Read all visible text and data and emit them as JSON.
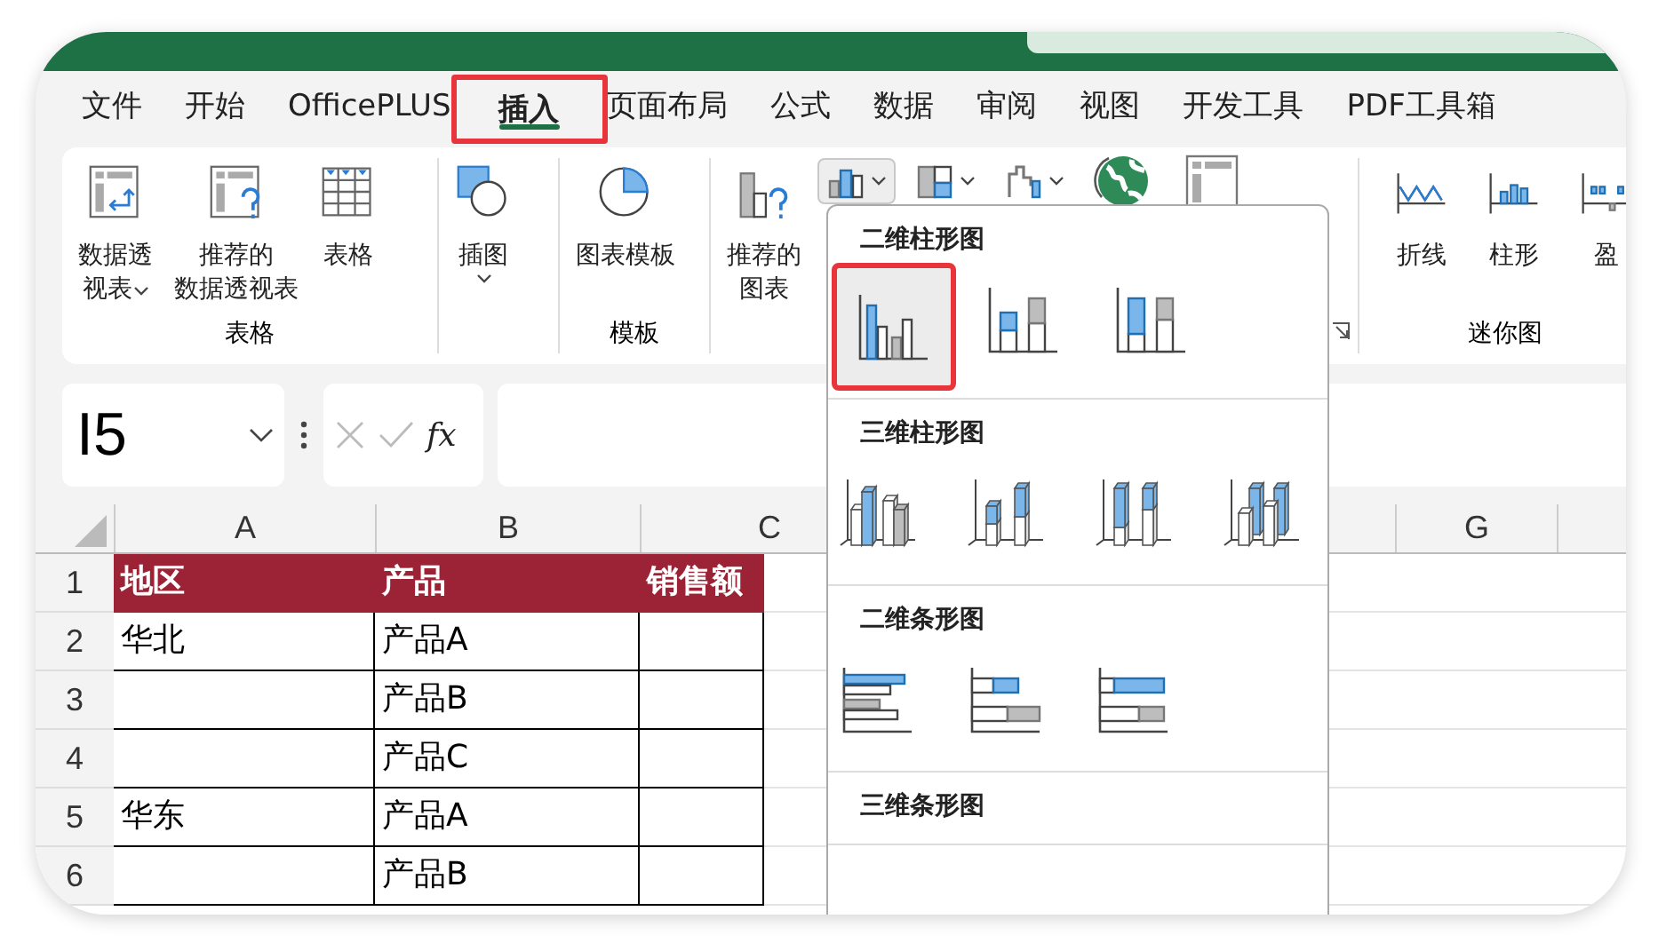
{
  "tabs": [
    {
      "label": "文件",
      "selected": false,
      "highlighted": false
    },
    {
      "label": "开始",
      "selected": false,
      "highlighted": false
    },
    {
      "label": "OfficePLUS",
      "selected": false,
      "highlighted": false
    },
    {
      "label": "插入",
      "selected": true,
      "highlighted": true
    },
    {
      "label": "页面布局",
      "selected": false,
      "highlighted": false
    },
    {
      "label": "公式",
      "selected": false,
      "highlighted": false
    },
    {
      "label": "数据",
      "selected": false,
      "highlighted": false
    },
    {
      "label": "审阅",
      "selected": false,
      "highlighted": false
    },
    {
      "label": "视图",
      "selected": false,
      "highlighted": false
    },
    {
      "label": "开发工具",
      "selected": false,
      "highlighted": false
    },
    {
      "label": "PDF工具箱",
      "selected": false,
      "highlighted": false
    }
  ],
  "ribbon": {
    "groups": [
      {
        "label": "表格",
        "buttons": [
          {
            "kind": "pivot",
            "lines": [
              "数据透",
              "视表"
            ],
            "dropdown": true
          },
          {
            "kind": "recommended-pivot",
            "lines": [
              "推荐的",
              "数据透视表"
            ],
            "dropdown": false
          },
          {
            "kind": "table",
            "lines": [
              "表格"
            ],
            "dropdown": false
          }
        ]
      },
      {
        "buttons": [
          {
            "kind": "illustration",
            "lines": [
              "插图"
            ],
            "dropdown": true
          }
        ]
      },
      {
        "label": "模板",
        "buttons": [
          {
            "kind": "chart-template",
            "lines": [
              "图表模板"
            ],
            "dropdown": false
          }
        ]
      },
      {
        "launcher": true,
        "buttons": [
          {
            "kind": "recommended-chart",
            "lines": [
              "推荐的",
              "图表"
            ],
            "dropdown": false
          },
          {
            "kind": "column-chart",
            "dropdown": true,
            "pressed": true
          },
          {
            "kind": "hierarchy-chart",
            "dropdown": true,
            "pressed": false
          },
          {
            "kind": "waterfall-chart",
            "dropdown": true,
            "pressed": false
          },
          {
            "kind": "globe",
            "dropdown": false,
            "pressed": false
          },
          {
            "kind": "pivot-chart",
            "dropdown": false,
            "pressed": false
          }
        ]
      },
      {
        "label": "迷你图",
        "buttons": [
          {
            "kind": "sparkline-line",
            "lines": [
              "折线"
            ],
            "dropdown": false
          },
          {
            "kind": "sparkline-column",
            "lines": [
              "柱形"
            ],
            "dropdown": false
          },
          {
            "kind": "sparkline-winloss",
            "lines": [
              "盈"
            ],
            "dropdown": false
          }
        ]
      }
    ]
  },
  "formula_bar": {
    "name_box": "I5",
    "function_label": "fx"
  },
  "sheet": {
    "columns": [
      {
        "label": "A"
      },
      {
        "label": "B"
      },
      {
        "label": "C"
      },
      {
        "label": "G"
      }
    ],
    "rows": [
      {
        "number": "1",
        "kind": "header",
        "cells": {
          "A": "地区",
          "B": "产品",
          "C": "销售额"
        }
      },
      {
        "number": "2",
        "kind": "data",
        "cells": {
          "A": "华北",
          "B": "产品A"
        }
      },
      {
        "number": "3",
        "kind": "data",
        "cells": {
          "B": "产品B"
        }
      },
      {
        "number": "4",
        "kind": "data",
        "cells": {
          "B": "产品C"
        }
      },
      {
        "number": "5",
        "kind": "data",
        "cells": {
          "A": "华东",
          "B": "产品A"
        }
      },
      {
        "number": "6",
        "kind": "data",
        "cells": {
          "B": "产品B"
        }
      }
    ]
  },
  "chart_menu": {
    "sections": [
      {
        "title": "二维柱形图",
        "options": [
          {
            "kind": "clustered-column",
            "selected": true,
            "highlighted": true
          },
          {
            "kind": "stacked-column",
            "selected": false,
            "highlighted": false
          },
          {
            "kind": "percent-column",
            "selected": false,
            "highlighted": false
          }
        ]
      },
      {
        "title": "三维柱形图",
        "options": [
          {
            "kind": "solidclustered",
            "selected": false,
            "highlighted": false
          },
          {
            "kind": "solidstacked",
            "selected": false,
            "highlighted": false
          },
          {
            "kind": "solidpercent",
            "selected": false,
            "highlighted": false
          },
          {
            "kind": "soliddepth",
            "selected": false,
            "highlighted": false
          }
        ]
      },
      {
        "title": "二维条形图",
        "options": [
          {
            "kind": "clustered-bar",
            "selected": false,
            "highlighted": false
          },
          {
            "kind": "stacked-bar",
            "selected": false,
            "highlighted": false
          },
          {
            "kind": "percent-bar",
            "selected": false,
            "highlighted": false
          }
        ]
      },
      {
        "title": "三维条形图"
      }
    ]
  }
}
